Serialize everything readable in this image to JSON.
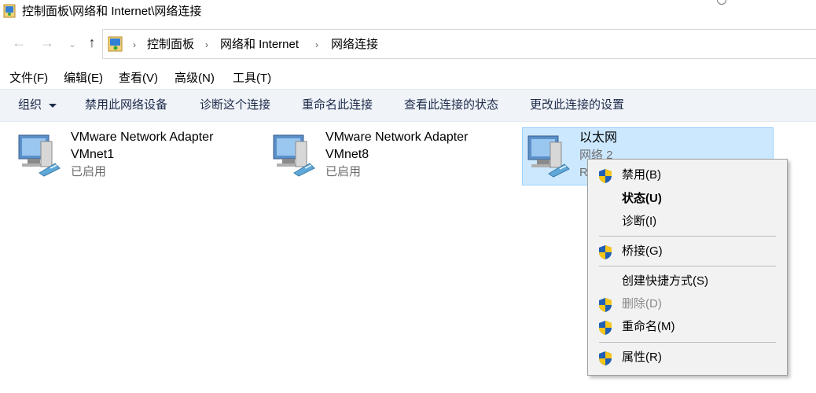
{
  "window": {
    "title": "控制面板\\网络和 Internet\\网络连接"
  },
  "address": {
    "back": "←",
    "forward": "→",
    "dropdown": "⌄",
    "up": "↑",
    "breadcrumb": [
      "控制面板",
      "网络和 Internet",
      "网络连接"
    ],
    "separator": "›"
  },
  "menubar": {
    "items": [
      "文件(F)",
      "编辑(E)",
      "查看(V)",
      "高级(N)",
      "工具(T)"
    ]
  },
  "commandbar": {
    "items": [
      "组织",
      "禁用此网络设备",
      "诊断这个连接",
      "重命名此连接",
      "查看此连接的状态",
      "更改此连接的设置"
    ]
  },
  "adapters": [
    {
      "name": "VMware Network Adapter",
      "name2": "VMnet1",
      "status": "已启用"
    },
    {
      "name": "VMware Network Adapter",
      "name2": "VMnet8",
      "status": "已启用"
    },
    {
      "name": "以太网",
      "name2": "网络 2",
      "status": "R",
      "selected": true
    }
  ],
  "context_menu": {
    "items": [
      {
        "label": "禁用(B)",
        "icon": "uac-shield-icon"
      },
      {
        "label": "状态(U)",
        "bold": true
      },
      {
        "label": "诊断(I)"
      },
      {
        "label": "桥接(G)",
        "icon": "uac-shield-icon"
      },
      {
        "label": "创建快捷方式(S)"
      },
      {
        "label": "删除(D)",
        "icon": "uac-shield-icon",
        "disabled": true
      },
      {
        "label": "重命名(M)",
        "icon": "uac-shield-icon"
      },
      {
        "label": "属性(R)",
        "icon": "uac-shield-icon"
      }
    ]
  },
  "colors": {
    "selection": "#cce8ff",
    "commandbar": "#f0f4f9",
    "shield_blue": "#1f5fb5",
    "shield_yellow": "#f5c518"
  }
}
